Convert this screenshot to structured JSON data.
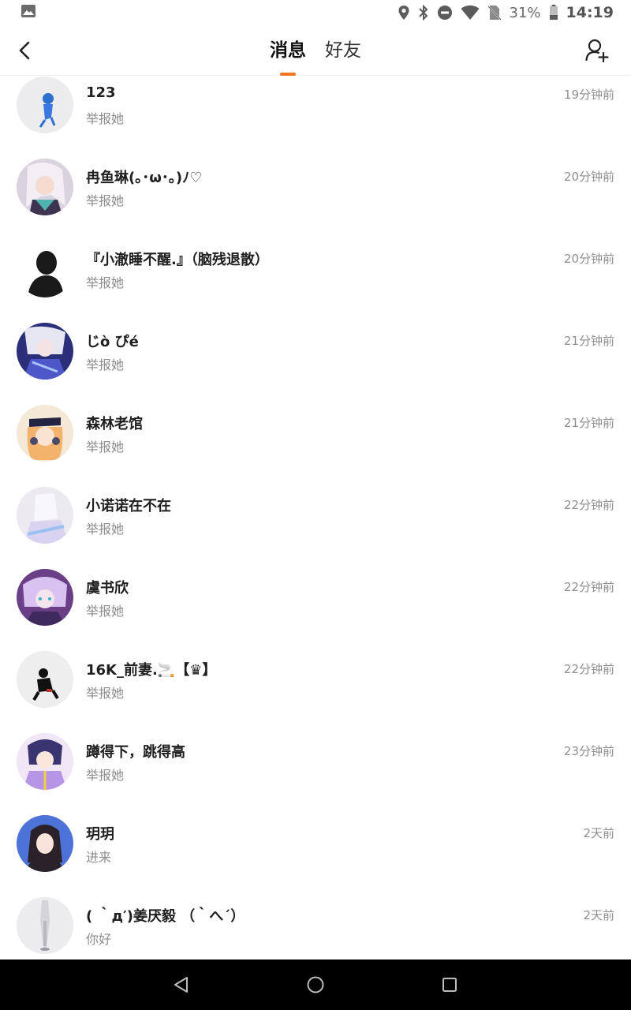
{
  "status_bar": {
    "battery_percent": "31%",
    "time": "14:19",
    "icons": [
      "image-icon",
      "location-icon",
      "bluetooth-icon",
      "dnd-icon",
      "wifi-icon",
      "no-sim-icon",
      "battery-icon"
    ]
  },
  "header": {
    "tabs": [
      {
        "label": "消息",
        "active": true
      },
      {
        "label": "好友",
        "active": false
      }
    ],
    "accent_color": "#f5761e"
  },
  "conversations": [
    {
      "name": "123",
      "subtitle": "举报她",
      "time": "19分钟前"
    },
    {
      "name": "冉鱼琳(｡･ω･｡)ﾉ♡",
      "subtitle": "举报她",
      "time": "20分钟前"
    },
    {
      "name": "『小澈睡不醒.』（脑残退散）",
      "subtitle": "举报她",
      "time": "20分钟前"
    },
    {
      "name": "じò ぴé",
      "subtitle": "举报她",
      "time": "21分钟前"
    },
    {
      "name": "森林老馆",
      "subtitle": "举报她",
      "time": "21分钟前"
    },
    {
      "name": "小诺诺在不在",
      "subtitle": "举报她",
      "time": "22分钟前"
    },
    {
      "name": "虞书欣",
      "subtitle": "举报她",
      "time": "22分钟前"
    },
    {
      "name": "16K_前妻.🚬【♛】",
      "subtitle": "举报她",
      "time": "22分钟前"
    },
    {
      "name": "蹲得下，跳得高",
      "subtitle": "举报她",
      "time": "23分钟前"
    },
    {
      "name": "玥玥",
      "subtitle": "进来",
      "time": "2天前"
    },
    {
      "name": "( ｀д′)姜厌毅 （｀へ´）",
      "subtitle": "你好",
      "time": "2天前"
    }
  ]
}
